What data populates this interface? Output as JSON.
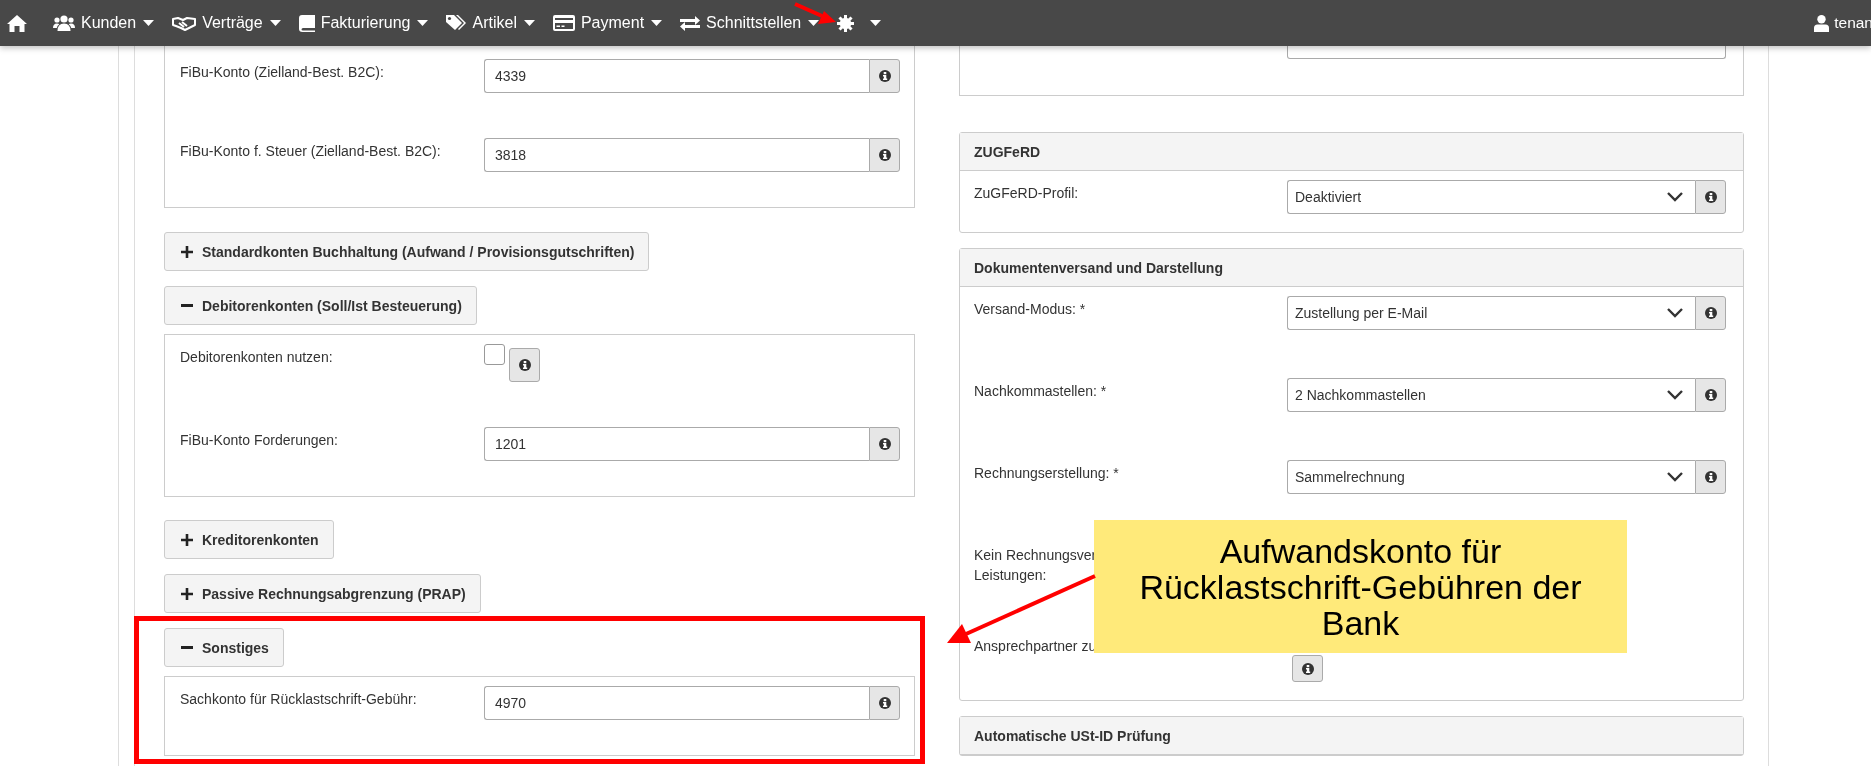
{
  "nav": {
    "items": [
      {
        "kind": "home"
      },
      {
        "kind": "menu",
        "label": "Kunden"
      },
      {
        "kind": "menu",
        "label": "Verträge"
      },
      {
        "kind": "menu",
        "label": "Fakturierung"
      },
      {
        "kind": "menu",
        "label": "Artikel"
      },
      {
        "kind": "menu",
        "label": "Payment"
      },
      {
        "kind": "menu",
        "label": "Schnittstellen"
      },
      {
        "kind": "settings"
      }
    ],
    "user": {
      "label": "tenan"
    }
  },
  "left_column": [
    {
      "kind": "panel",
      "fields": [
        {
          "kind": "text",
          "label": "FiBu-Konto (Zielland-Best. B2C):",
          "value": "4339"
        },
        {
          "kind": "text",
          "label": "FiBu-Konto f. Steuer (Zielland-Best. B2C):",
          "value": "3818"
        }
      ]
    },
    {
      "kind": "section",
      "label": "Standardkonten Buchhaltung (Aufwand / Provisionsgutschriften)",
      "expanded": false
    },
    {
      "kind": "section",
      "label": "Debitorenkonten (Soll/Ist Besteuerung)",
      "expanded": true,
      "fields": [
        {
          "kind": "checkbox",
          "label": "Debitorenkonten nutzen:",
          "checked": false
        },
        {
          "kind": "text",
          "label": "FiBu-Konto Forderungen:",
          "value": "1201"
        }
      ]
    },
    {
      "kind": "section",
      "label": "Kreditorenkonten",
      "expanded": false
    },
    {
      "kind": "section",
      "label": "Passive Rechnungsabgrenzung (PRAP)",
      "expanded": false
    },
    {
      "kind": "section",
      "label": "Sonstiges",
      "expanded": true,
      "highlighted": true,
      "fields": [
        {
          "kind": "text",
          "label": "Sachkonto für Rücklastschrift-Gebühr:",
          "value": "4970"
        }
      ]
    }
  ],
  "right_column": [
    {
      "kind": "panel",
      "fields": [
        {
          "kind": "cut"
        }
      ]
    },
    {
      "kind": "card",
      "title": "ZUGFeRD",
      "fields": [
        {
          "kind": "select",
          "label": "ZuGFeRD-Profil:",
          "value": "Deaktiviert"
        }
      ]
    },
    {
      "kind": "card",
      "title": "Dokumentenversand und Darstellung",
      "fields": [
        {
          "kind": "select",
          "label": "Versand-Modus: *",
          "value": "Zustellung per E-Mail"
        },
        {
          "kind": "select",
          "label": "Nachkommastellen: *",
          "value": "2 Nachkommastellen"
        },
        {
          "kind": "select",
          "label": "Rechnungserstellung: *",
          "value": "Sammelrechnung"
        },
        {
          "kind": "label_only",
          "label": [
            "Kein Rechnungsver",
            "Leistungen:"
          ]
        },
        {
          "kind": "info_only",
          "label": "Ansprechpartner zu"
        }
      ]
    },
    {
      "kind": "card",
      "title": "Automatische USt-ID Prüfung"
    }
  ],
  "callout": {
    "text": "Aufwandskonto für Rücklastschrift-Gebühren der Bank"
  }
}
